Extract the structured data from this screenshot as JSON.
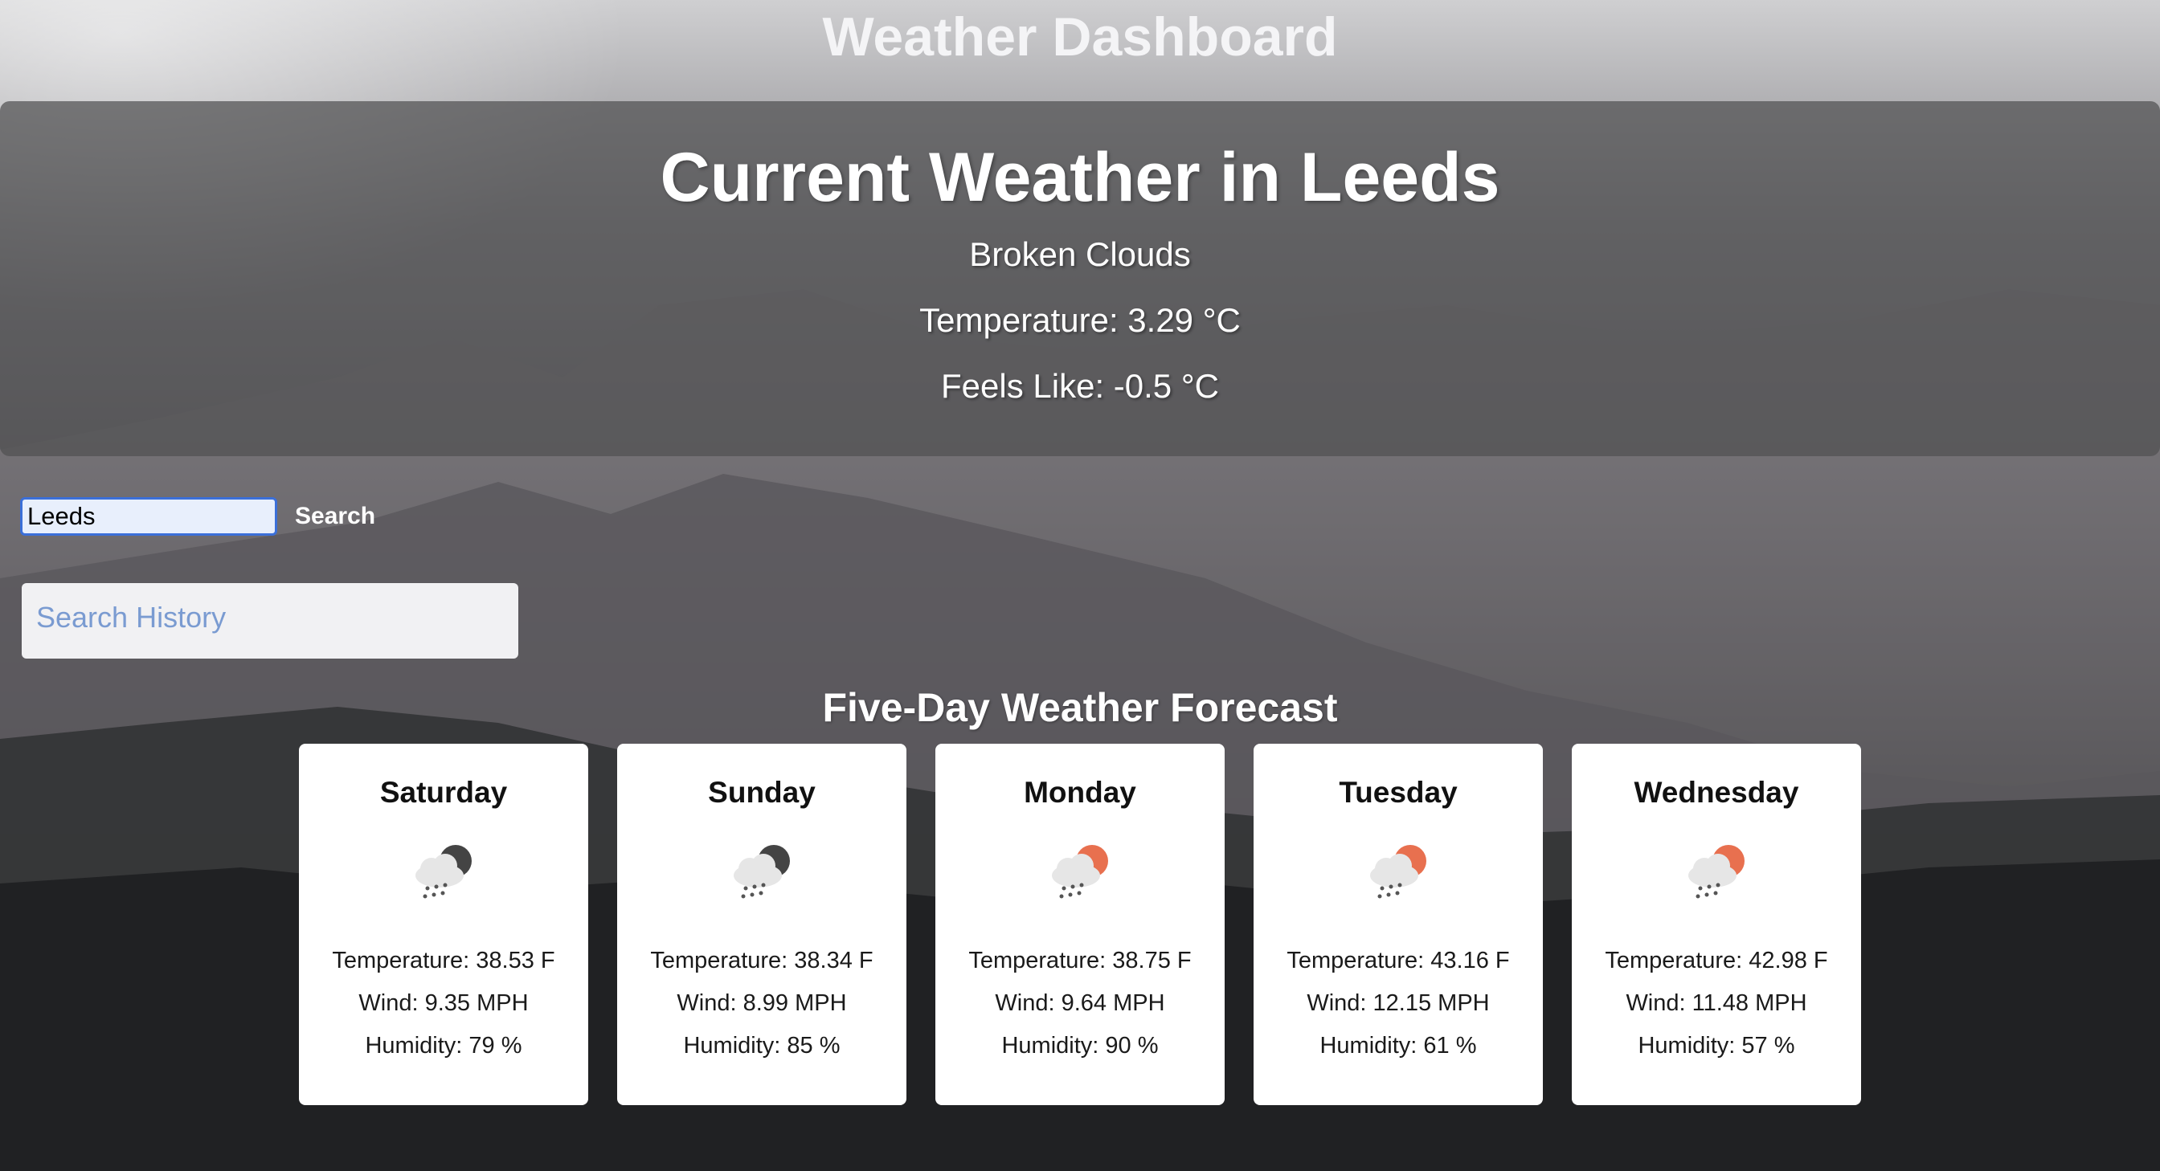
{
  "header": {
    "title": "Weather Dashboard"
  },
  "current": {
    "title": "Current Weather in Leeds",
    "description": "Broken Clouds",
    "temperature": "Temperature: 3.29 °C",
    "feels_like": "Feels Like: -0.5 °C"
  },
  "search": {
    "value": "Leeds",
    "button_label": "Search"
  },
  "history": {
    "label": "Search History"
  },
  "forecast": {
    "title": "Five-Day Weather Forecast",
    "days": [
      {
        "day": "Saturday",
        "icon": "rain-night-icon",
        "temperature": "Temperature: 38.53 F",
        "wind": "Wind: 9.35 MPH",
        "humidity": "Humidity: 79 %"
      },
      {
        "day": "Sunday",
        "icon": "rain-night-icon",
        "temperature": "Temperature: 38.34 F",
        "wind": "Wind: 8.99 MPH",
        "humidity": "Humidity: 85 %"
      },
      {
        "day": "Monday",
        "icon": "rain-day-icon",
        "temperature": "Temperature: 38.75 F",
        "wind": "Wind: 9.64 MPH",
        "humidity": "Humidity: 90 %"
      },
      {
        "day": "Tuesday",
        "icon": "rain-day-icon",
        "temperature": "Temperature: 43.16 F",
        "wind": "Wind: 12.15 MPH",
        "humidity": "Humidity: 61 %"
      },
      {
        "day": "Wednesday",
        "icon": "rain-day-icon",
        "temperature": "Temperature: 42.98 F",
        "wind": "Wind: 11.48 MPH",
        "humidity": "Humidity: 57 %"
      }
    ]
  },
  "colors": {
    "panel": "#505052",
    "input_border": "#3b6fd8",
    "history_text": "#7a9bd1",
    "sun": "#e8704f",
    "moon": "#444444",
    "cloud": "#e6e6e6"
  }
}
